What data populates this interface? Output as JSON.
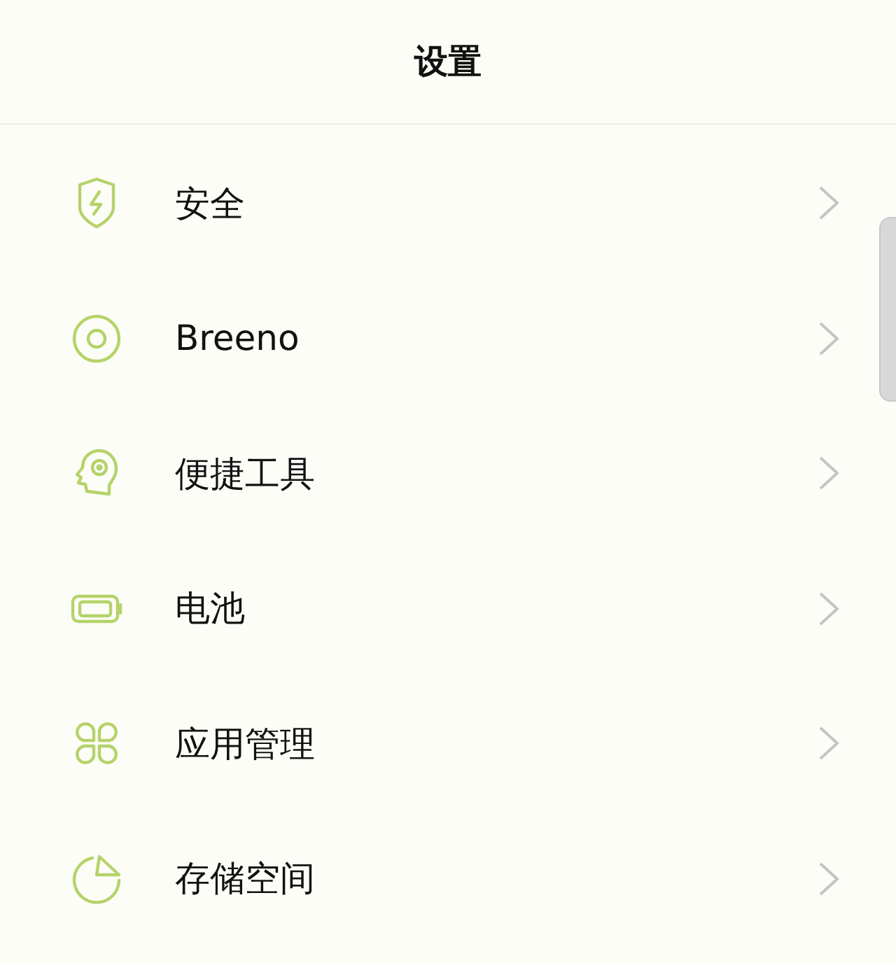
{
  "header": {
    "title": "设置"
  },
  "items": [
    {
      "label": "安全"
    },
    {
      "label": "Breeno"
    },
    {
      "label": "便捷工具"
    },
    {
      "label": "电池"
    },
    {
      "label": "应用管理"
    },
    {
      "label": "存储空间"
    }
  ]
}
